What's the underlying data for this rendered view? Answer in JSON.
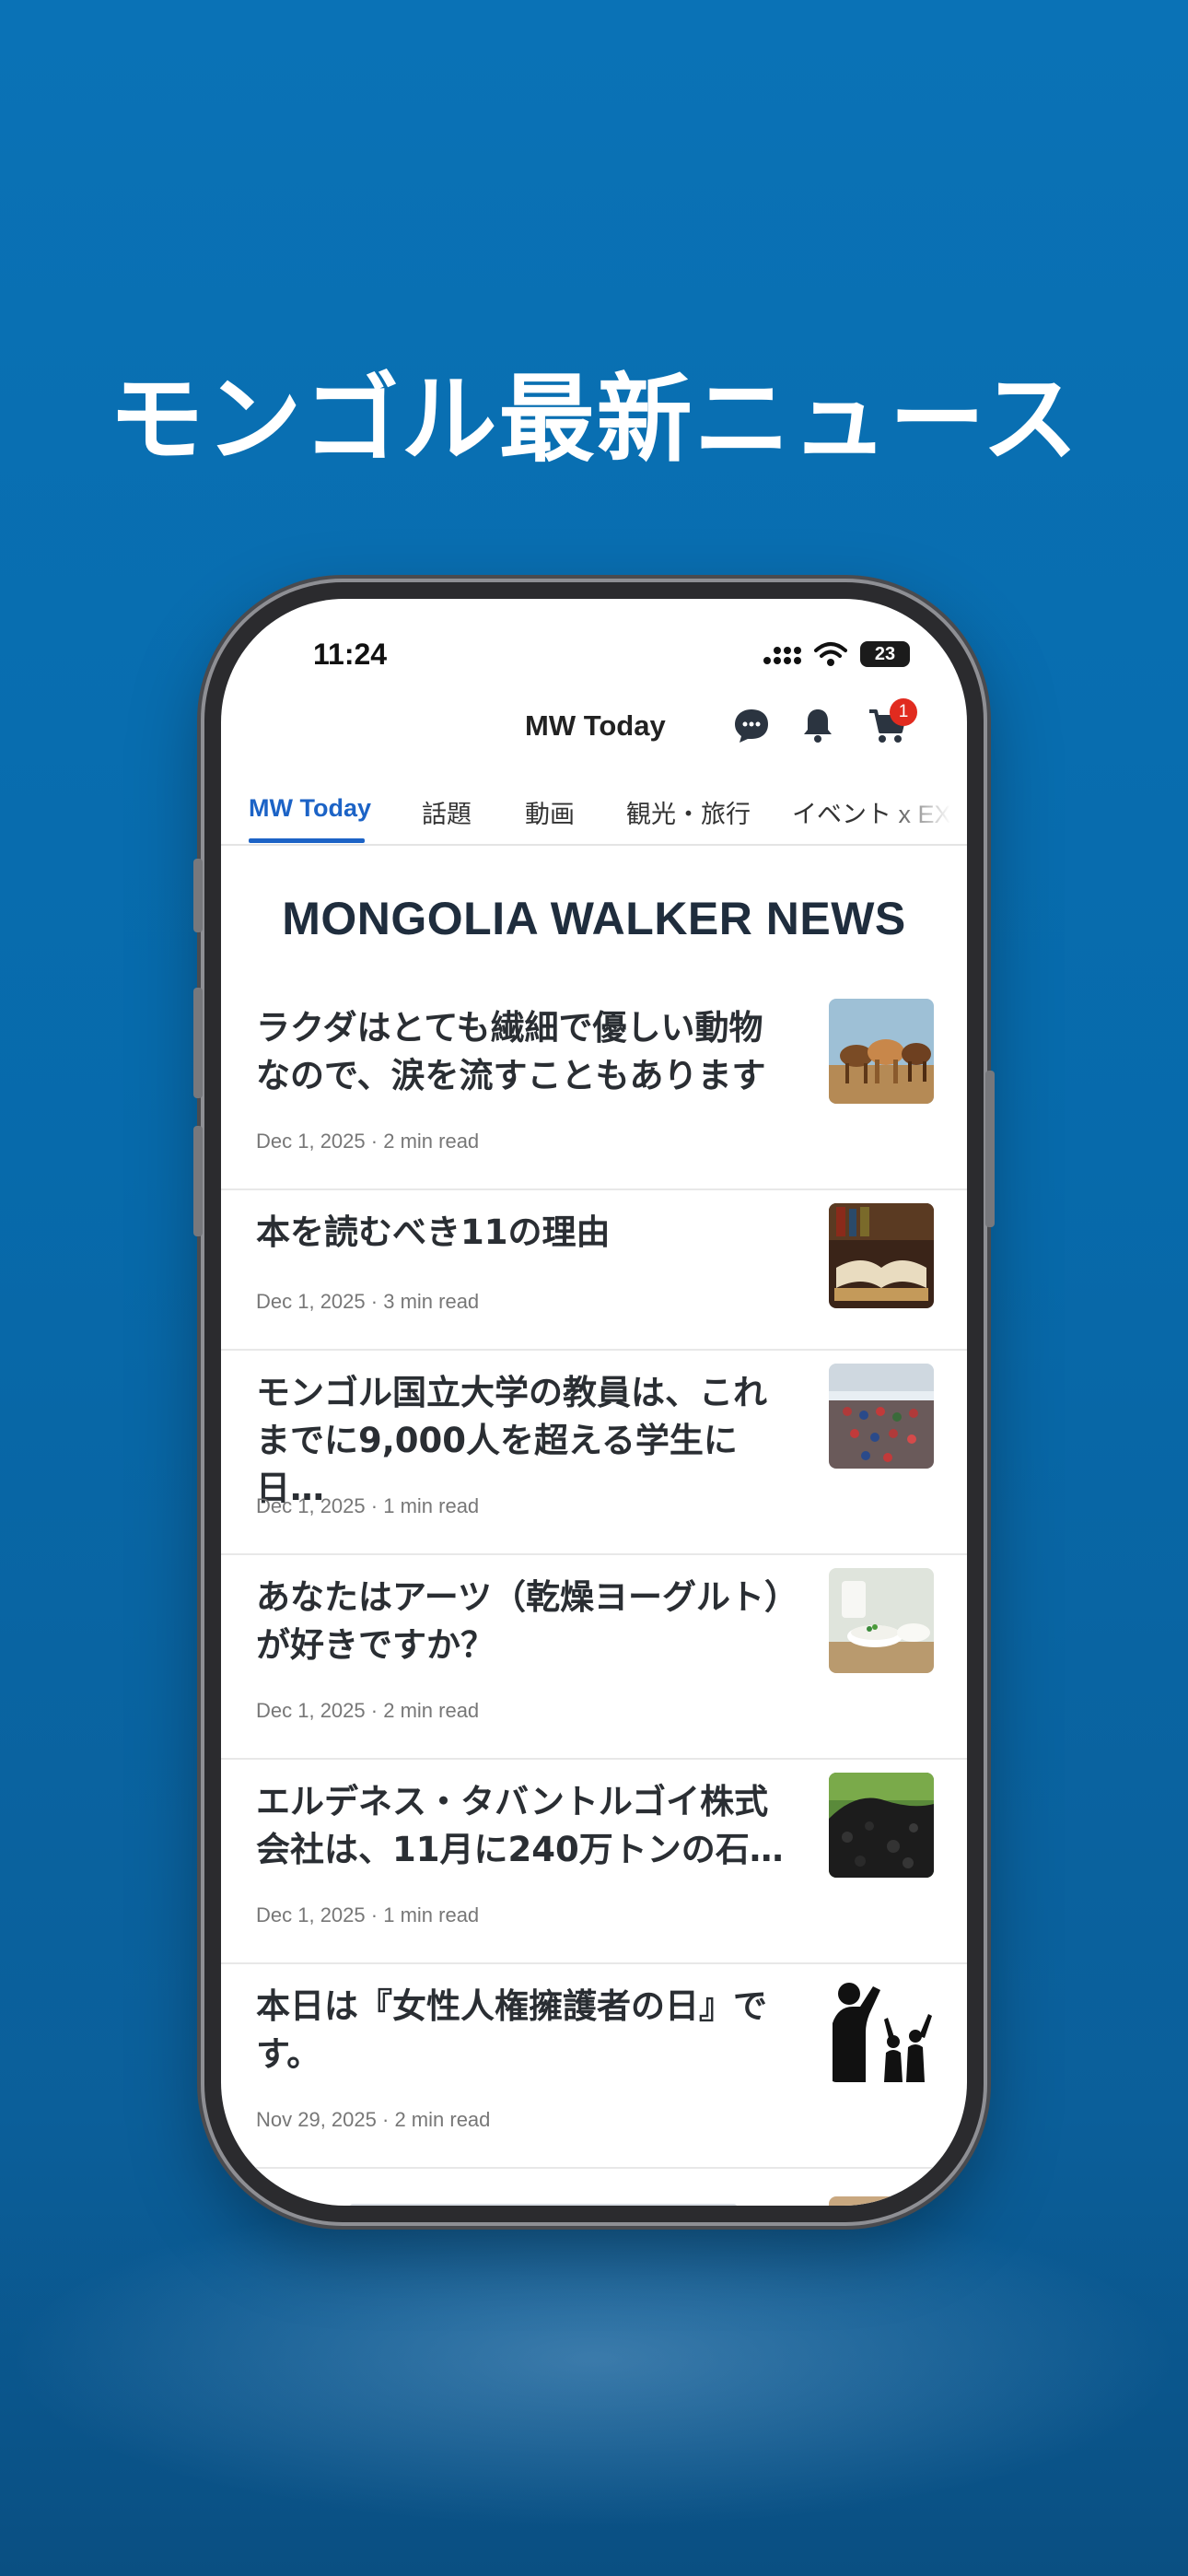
{
  "headline": "モンゴル最新ニュース",
  "status_bar": {
    "time": "11:24",
    "battery": "23"
  },
  "app_bar": {
    "title": "MW Today",
    "cart_count": "1"
  },
  "tabs": [
    {
      "label": "MW Today",
      "active": true
    },
    {
      "label": "話題",
      "active": false
    },
    {
      "label": "動画",
      "active": false
    },
    {
      "label": "観光・旅行",
      "active": false
    },
    {
      "label": "イベント x EX",
      "active": false
    }
  ],
  "section_title": "MONGOLIA WALKER NEWS",
  "articles": [
    {
      "title": "ラクダはとても繊細で優しい動物なので、涙を流すこともあります",
      "date": "Dec 1, 2025",
      "read_time": "2 min read",
      "thumb": "camels-thumbnail"
    },
    {
      "title": "本を読むべき11の理由",
      "date": "Dec 1, 2025",
      "read_time": "3 min read",
      "thumb": "books-thumbnail"
    },
    {
      "title": "モンゴル国立大学の教員は、これまでに9,000人を超える学生に日…",
      "date": "Dec 1, 2025",
      "read_time": "1 min read",
      "thumb": "lecture-hall-thumbnail"
    },
    {
      "title": "あなたはアーツ（乾燥ヨーグルト）が好きですか？",
      "date": "Dec 1, 2025",
      "read_time": "2 min read",
      "thumb": "yogurt-thumbnail"
    },
    {
      "title": "エルデネス・タバントルゴイ株式会社は、11月に240万トンの石…",
      "date": "Dec 1, 2025",
      "read_time": "1 min read",
      "thumb": "coal-thumbnail"
    },
    {
      "title": "本日は『女性人権擁護者の日』です。",
      "date": "Nov 29, 2025",
      "read_time": "2 min read",
      "thumb": "protest-silhouette-thumbnail"
    }
  ],
  "meta_separator": "·",
  "colors": {
    "background": "#0a72b6",
    "accent": "#1c63c6",
    "badge": "#e12b1f"
  }
}
